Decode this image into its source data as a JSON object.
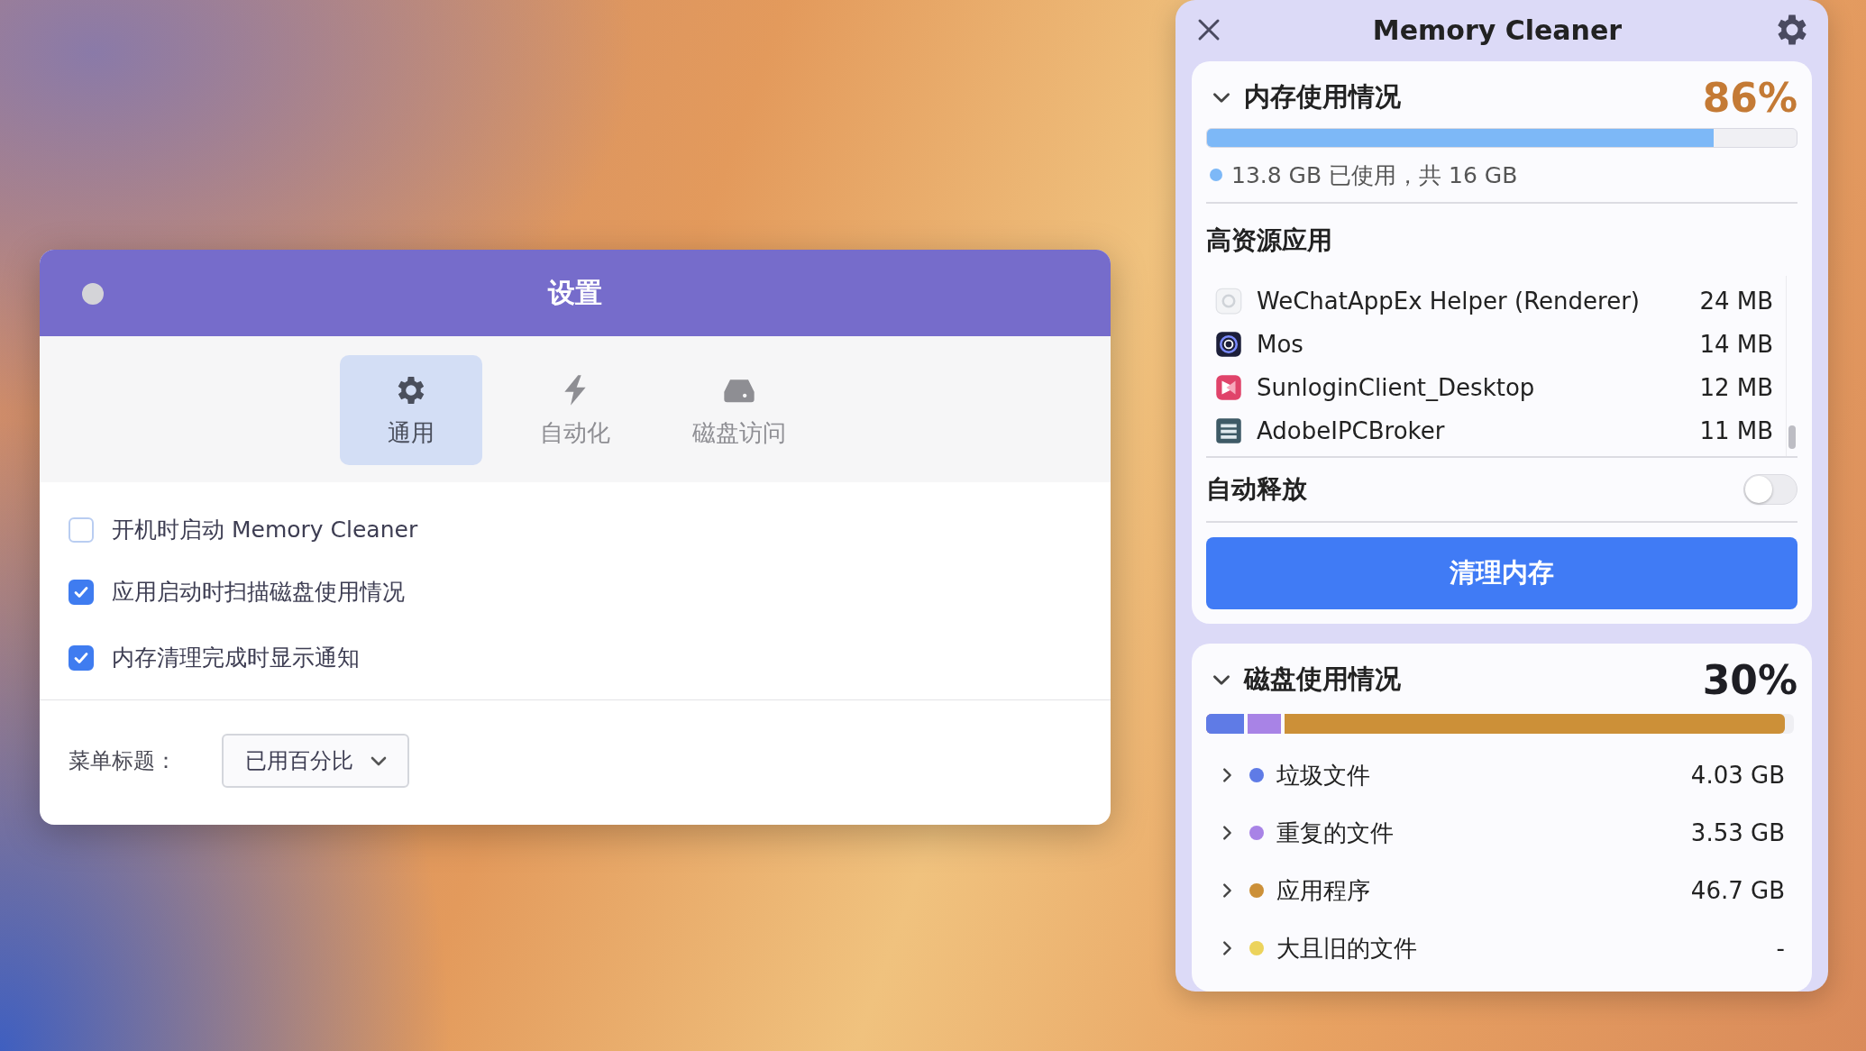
{
  "settings_window": {
    "title": "设置",
    "tabs": [
      {
        "label": "通用",
        "selected": true
      },
      {
        "label": "自动化",
        "selected": false
      },
      {
        "label": "磁盘访问",
        "selected": false
      }
    ],
    "options": [
      {
        "label": "开机时启动 Memory Cleaner",
        "checked": false
      },
      {
        "label": "应用启动时扫描磁盘使用情况",
        "checked": true
      },
      {
        "label": "内存清理完成时显示通知",
        "checked": true
      }
    ],
    "menu_title": {
      "label": "菜单标题：",
      "value": "已用百分比"
    }
  },
  "memory_cleaner": {
    "title": "Memory Cleaner",
    "memory": {
      "title": "内存使用情况",
      "expanded": true,
      "percent": "86%",
      "high": true,
      "level": 0.86,
      "usage": "13.8 GB 已使用，共 16 GB"
    },
    "top_apps": {
      "title": "高资源应用",
      "apps": [
        {
          "name": "WeChatAppEx Helper (Renderer)",
          "size": "24 MB"
        },
        {
          "name": "Mos",
          "size": "14 MB"
        },
        {
          "name": "SunloginClient_Desktop",
          "size": "12 MB"
        },
        {
          "name": "AdobeIPCBroker",
          "size": "11 MB"
        }
      ]
    },
    "auto_release": {
      "label": "自动释放",
      "on": false
    },
    "clean_button": "清理内存",
    "disk": {
      "title": "磁盘使用情况",
      "expanded": true,
      "percent": "30%",
      "high": false,
      "categories": [
        {
          "name": "垃圾文件",
          "size": "4.03 GB",
          "color": "#5f7be6",
          "level": 0.07,
          "expanded": false
        },
        {
          "name": "重复的文件",
          "size": "3.53 GB",
          "color": "#a883e6",
          "level": 0.134,
          "expanded": false
        },
        {
          "name": "应用程序",
          "size": "46.7 GB",
          "color": "#cc9038",
          "level": 0.985,
          "expanded": false
        },
        {
          "name": "大且旧的文件",
          "size": "-",
          "color": "#ecd35c",
          "expanded": false
        }
      ]
    }
  }
}
